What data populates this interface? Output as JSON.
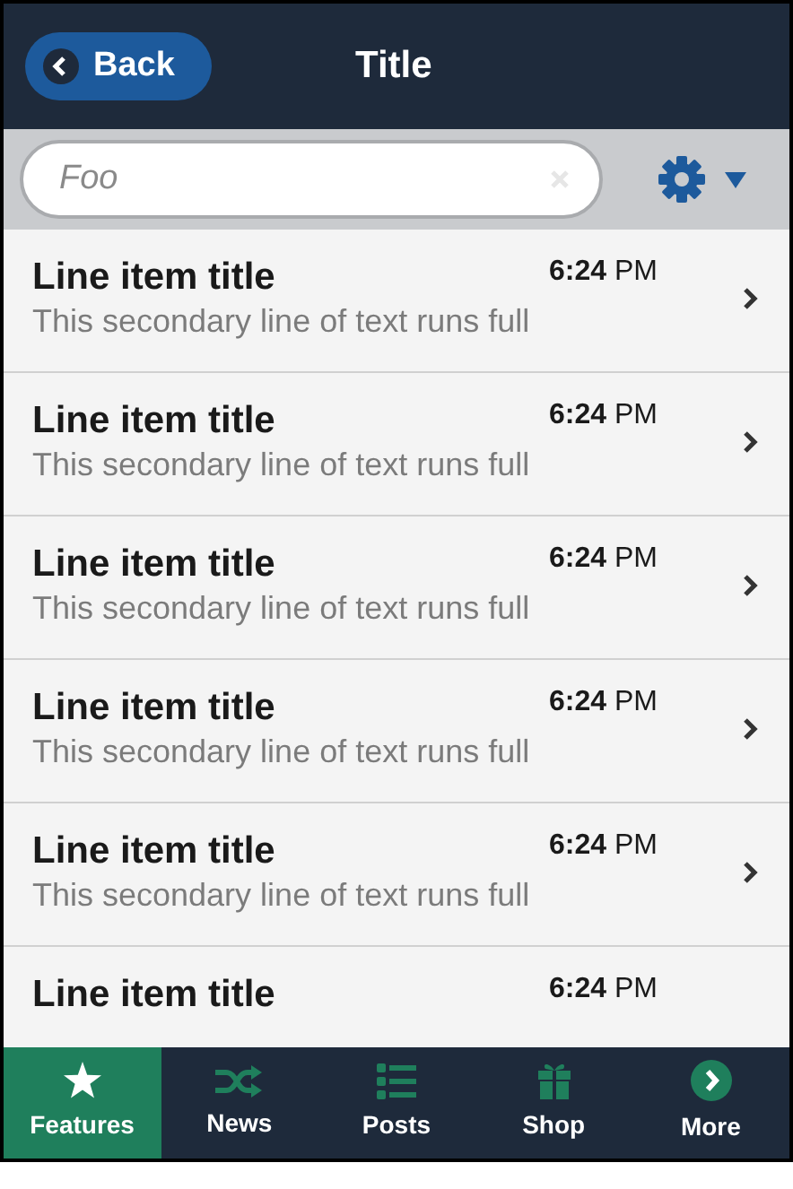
{
  "header": {
    "back_button": "Back",
    "title": "Title"
  },
  "search": {
    "placeholder": "Foo"
  },
  "list": [
    {
      "title": "Line item title",
      "time": "6:24",
      "period": "PM",
      "subtitle": "This secondary line of text runs full"
    },
    {
      "title": "Line item title",
      "time": "6:24",
      "period": "PM",
      "subtitle": "This secondary line of text runs full"
    },
    {
      "title": "Line item title",
      "time": "6:24",
      "period": "PM",
      "subtitle": "This secondary line of text runs full"
    },
    {
      "title": "Line item title",
      "time": "6:24",
      "period": "PM",
      "subtitle": "This secondary line of text runs full"
    },
    {
      "title": "Line item title",
      "time": "6:24",
      "period": "PM",
      "subtitle": "This secondary line of text runs full"
    },
    {
      "title": "Line item title",
      "time": "6:24",
      "period": "PM"
    }
  ],
  "tabs": [
    {
      "label": "Features",
      "kind": "star",
      "selected": true
    },
    {
      "label": "News",
      "kind": "shuffle",
      "selected": false
    },
    {
      "label": "Posts",
      "kind": "list",
      "selected": false
    },
    {
      "label": "Shop",
      "kind": "gift",
      "selected": false
    },
    {
      "label": "More",
      "kind": "more",
      "selected": false
    }
  ]
}
